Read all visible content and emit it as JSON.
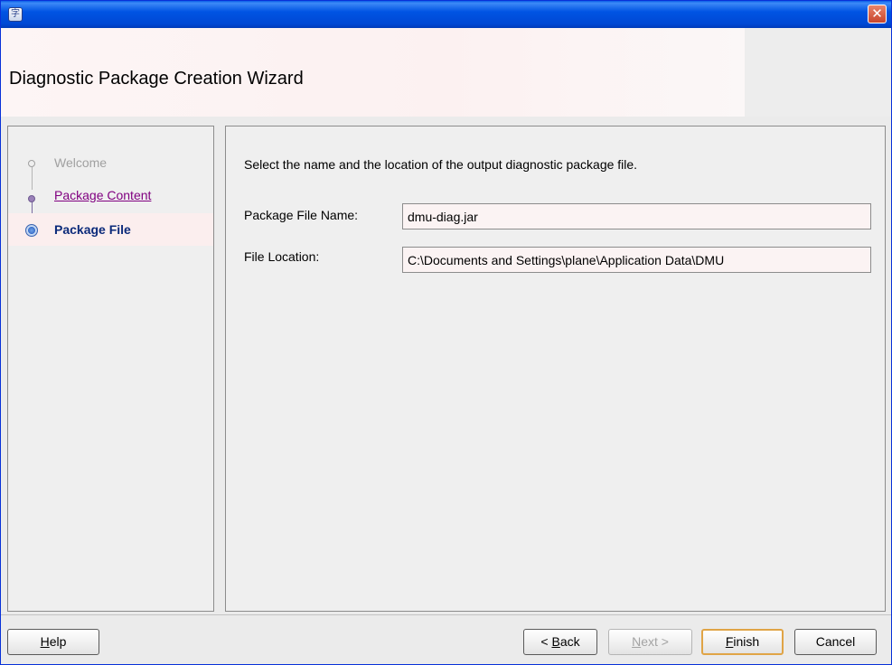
{
  "window": {
    "app_icon_glyph": "字",
    "close_glyph": "✕"
  },
  "header": {
    "title": "Diagnostic Package Creation Wizard"
  },
  "steps": [
    {
      "label": "Welcome",
      "state": "visited-disabled",
      "color": "#a0a0a0"
    },
    {
      "label": "Package Content",
      "state": "visited-link",
      "color": "#800080"
    },
    {
      "label": "Package File",
      "state": "current",
      "color": "#0b2a7a"
    }
  ],
  "main": {
    "instruction": "Select the name and the location of the output diagnostic package file.",
    "fields": {
      "package_file_name": {
        "label": "Package File Name:",
        "value": "dmu-diag.jar"
      },
      "file_location": {
        "label": "File Location:",
        "value": "C:\\Documents and Settings\\plane\\Application Data\\DMU"
      }
    }
  },
  "footer": {
    "help": {
      "pre": "",
      "mn": "H",
      "post": "elp"
    },
    "back": {
      "pre": "< ",
      "mn": "B",
      "post": "ack"
    },
    "next": {
      "pre": "",
      "mn": "N",
      "post": "ext >"
    },
    "finish": {
      "pre": "",
      "mn": "F",
      "post": "inish"
    },
    "cancel": {
      "label": "Cancel"
    }
  },
  "colors": {
    "titlebar": "#0054e3",
    "default_button_border": "#e0a446",
    "current_step_text": "#0b2a7a"
  }
}
